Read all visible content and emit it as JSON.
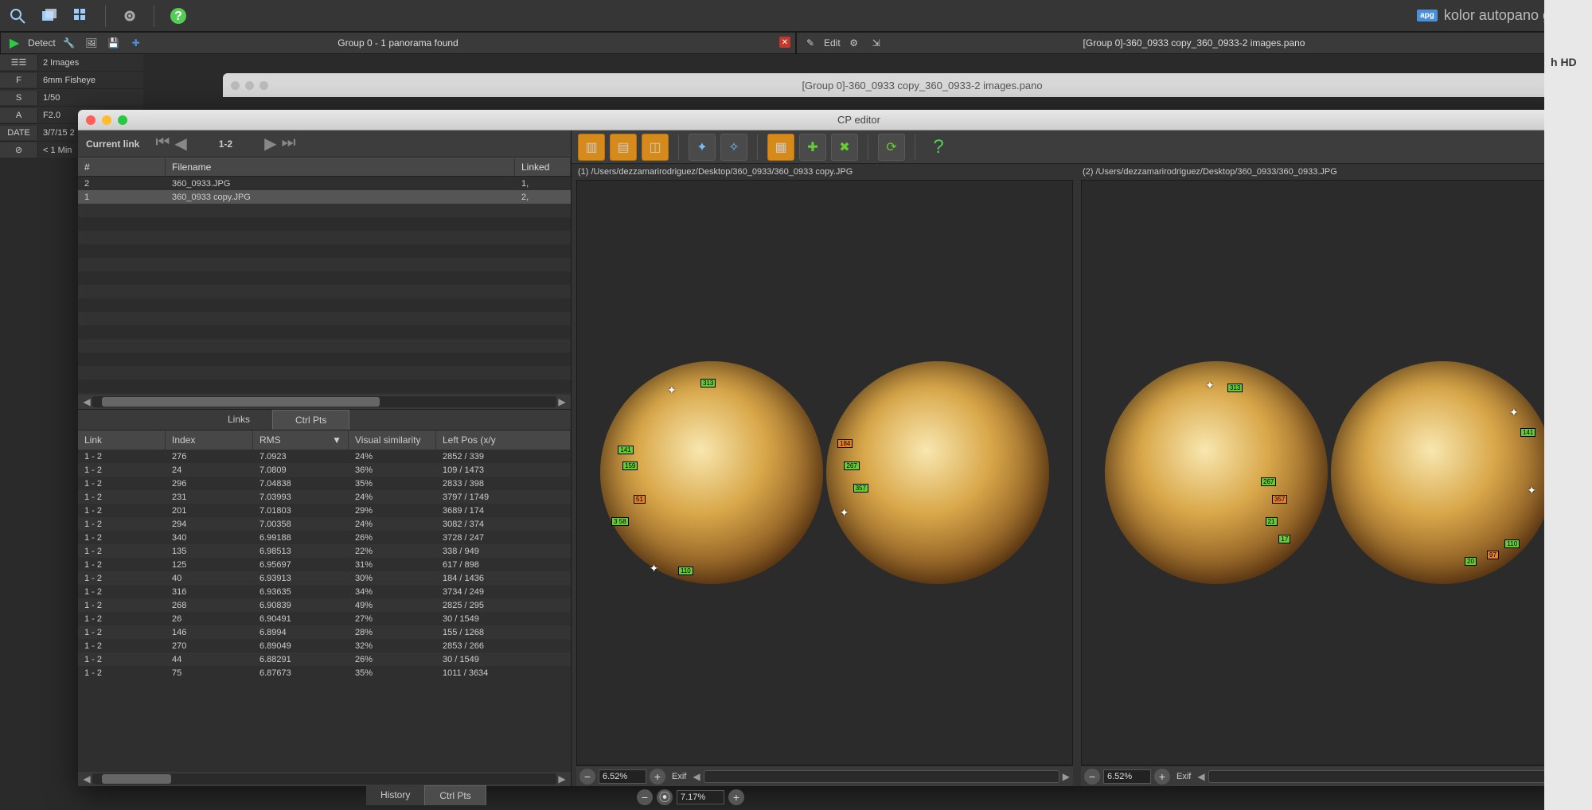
{
  "brand": {
    "badge": "apg",
    "name": "kolor autopano giga"
  },
  "main_toolbar": {
    "icons": [
      "magnifier",
      "images",
      "grid",
      "gear",
      "help"
    ]
  },
  "group_panel": {
    "detect_label": "Detect",
    "title": "Group 0 - 1 panorama found"
  },
  "edit_panel": {
    "edit_label": "Edit",
    "title": "[Group 0]-360_0933 copy_360_0933-2 images.pano"
  },
  "meta": [
    {
      "k": "☰☰",
      "v": "2 Images"
    },
    {
      "k": "F",
      "v": "6mm Fisheye"
    },
    {
      "k": "S",
      "v": "1/50"
    },
    {
      "k": "A",
      "v": "F2.0"
    },
    {
      "k": "DATE",
      "v": "3/7/15 2"
    },
    {
      "k": "⊘",
      "v": "< 1 Min"
    }
  ],
  "doc_tab_title": "[Group 0]-360_0933 copy_360_0933-2 images.pano",
  "cp_editor": {
    "title": "CP editor",
    "nav": {
      "label": "Current link",
      "index": "1-2"
    },
    "file_table": {
      "cols": [
        "#",
        "Filename",
        "Linked"
      ],
      "rows": [
        {
          "n": "2",
          "f": "360_0933.JPG",
          "l": "1,"
        },
        {
          "n": "1",
          "f": "360_0933 copy.JPG",
          "l": "2,"
        }
      ]
    },
    "tabs": {
      "links": "Links",
      "ctrl": "Ctrl Pts",
      "active": "ctrl"
    },
    "cp_table": {
      "cols": [
        "Link",
        "Index",
        "RMS",
        "Visual similarity",
        "Left Pos (x/y"
      ],
      "rows": [
        {
          "link": "1 - 2",
          "index": "276",
          "rms": "7.0923",
          "vis": "24%",
          "pos": "2852 / 339"
        },
        {
          "link": "1 - 2",
          "index": "24",
          "rms": "7.0809",
          "vis": "36%",
          "pos": "109 / 1473"
        },
        {
          "link": "1 - 2",
          "index": "296",
          "rms": "7.04838",
          "vis": "35%",
          "pos": "2833 / 398"
        },
        {
          "link": "1 - 2",
          "index": "231",
          "rms": "7.03993",
          "vis": "24%",
          "pos": "3797 / 1749"
        },
        {
          "link": "1 - 2",
          "index": "201",
          "rms": "7.01803",
          "vis": "29%",
          "pos": "3689 / 174"
        },
        {
          "link": "1 - 2",
          "index": "294",
          "rms": "7.00358",
          "vis": "24%",
          "pos": "3082 / 374"
        },
        {
          "link": "1 - 2",
          "index": "340",
          "rms": "6.99188",
          "vis": "26%",
          "pos": "3728 / 247"
        },
        {
          "link": "1 - 2",
          "index": "135",
          "rms": "6.98513",
          "vis": "22%",
          "pos": "338 / 949"
        },
        {
          "link": "1 - 2",
          "index": "125",
          "rms": "6.95697",
          "vis": "31%",
          "pos": "617 / 898"
        },
        {
          "link": "1 - 2",
          "index": "40",
          "rms": "6.93913",
          "vis": "30%",
          "pos": "184 / 1436"
        },
        {
          "link": "1 - 2",
          "index": "316",
          "rms": "6.93635",
          "vis": "34%",
          "pos": "3734 / 249"
        },
        {
          "link": "1 - 2",
          "index": "268",
          "rms": "6.90839",
          "vis": "49%",
          "pos": "2825 / 295"
        },
        {
          "link": "1 - 2",
          "index": "26",
          "rms": "6.90491",
          "vis": "27%",
          "pos": "30 / 1549"
        },
        {
          "link": "1 - 2",
          "index": "146",
          "rms": "6.8994",
          "vis": "28%",
          "pos": "155 / 1268"
        },
        {
          "link": "1 - 2",
          "index": "270",
          "rms": "6.89049",
          "vis": "32%",
          "pos": "2853 / 266"
        },
        {
          "link": "1 - 2",
          "index": "44",
          "rms": "6.88291",
          "vis": "26%",
          "pos": "30 / 1549"
        },
        {
          "link": "1 - 2",
          "index": "75",
          "rms": "6.87673",
          "vis": "35%",
          "pos": "1011 / 3634"
        }
      ]
    },
    "viewer1": {
      "path": "(1) /Users/dezzamarirodriguez/Desktop/360_0933/360_0933 copy.JPG",
      "zoom": "6.52%",
      "exif": "Exif"
    },
    "viewer2": {
      "path": "(2) /Users/dezzamarirodriguez/Desktop/360_0933/360_0933.JPG",
      "zoom": "6.52%",
      "exif": "Exif"
    }
  },
  "bottom": {
    "history": "History",
    "ctrl": "Ctrl Pts",
    "zoom": "7.17%"
  },
  "right_strip": {
    "label": "h HD"
  }
}
